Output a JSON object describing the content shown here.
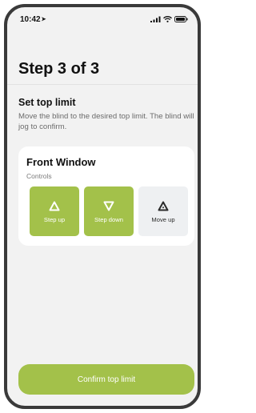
{
  "status_bar": {
    "time": "10:42",
    "location_icon": "location-arrow-icon",
    "signal_icon": "cellular-signal-icon",
    "wifi_icon": "wifi-icon",
    "battery_icon": "battery-icon"
  },
  "header": {
    "title": "Step 3 of 3"
  },
  "section": {
    "title": "Set top limit",
    "description": "Move the blind to the desired top limit. The blind will jog to confirm."
  },
  "card": {
    "title": "Front Window",
    "subtitle": "Controls",
    "buttons": [
      {
        "label": "Step up",
        "icon": "step-up-icon",
        "style": "primary"
      },
      {
        "label": "Step down",
        "icon": "step-down-icon",
        "style": "primary"
      },
      {
        "label": "Move up",
        "icon": "move-up-icon",
        "style": "neutral"
      }
    ]
  },
  "footer": {
    "confirm_label": "Confirm top limit"
  },
  "colors": {
    "accent": "#a3c14a",
    "background": "#f2f2f2",
    "card": "#ffffff",
    "neutral_button": "#eef0f2",
    "frame": "#3a3a3a"
  }
}
